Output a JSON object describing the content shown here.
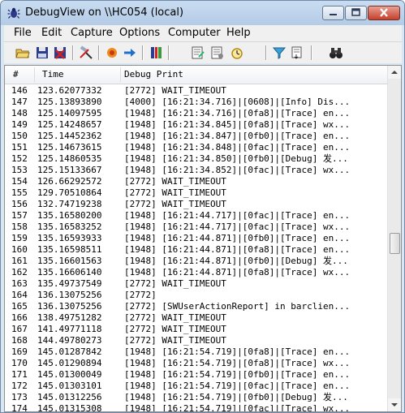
{
  "window": {
    "title": "DebugView on \\\\HC054 (local)"
  },
  "menu": [
    "File",
    "Edit",
    "Capture",
    "Options",
    "Computer",
    "Help"
  ],
  "toolbar": {
    "icons": [
      "open-icon",
      "save-icon",
      "clear-icon",
      "capture-icon",
      "autoscroll-icon",
      "find-icon",
      "filter-icon",
      "highlight-icon",
      "properties-icon",
      "timer-icon",
      "filter-funnel-icon",
      "history-icon",
      "binoculars-icon"
    ]
  },
  "columns": {
    "num": "#",
    "time": "Time",
    "print": "Debug Print"
  },
  "rows": [
    {
      "n": "146",
      "t": "123.62077332",
      "p": "[2772] WAIT_TIMEOUT"
    },
    {
      "n": "147",
      "t": "125.13893890",
      "p": "[4000] [16:21:34.716]|[0608]|[Info] Dis..."
    },
    {
      "n": "148",
      "t": "125.14097595",
      "p": "[1948] [16:21:34.716]|[0fa8]|[Trace] en..."
    },
    {
      "n": "149",
      "t": "125.14248657",
      "p": "[1948] [16:21:34.845]|[0fa8]|[Trace] wx..."
    },
    {
      "n": "150",
      "t": "125.14452362",
      "p": "[1948] [16:21:34.847]|[0fb0]|[Trace] en..."
    },
    {
      "n": "151",
      "t": "125.14673615",
      "p": "[1948] [16:21:34.848]|[0fac]|[Trace] en..."
    },
    {
      "n": "152",
      "p": "[1948] [16:21:34.850]|[0fb0]|[Debug] 发...",
      "t": "125.14860535"
    },
    {
      "n": "153",
      "t": "125.15133667",
      "p": "[1948] [16:21:34.852]|[0fac]|[Trace] wx..."
    },
    {
      "n": "154",
      "t": "126.66292572",
      "p": "[2772] WAIT_TIMEOUT"
    },
    {
      "n": "155",
      "t": "129.70510864",
      "p": "[2772] WAIT_TIMEOUT"
    },
    {
      "n": "156",
      "t": "132.74719238",
      "p": "[2772] WAIT_TIMEOUT"
    },
    {
      "n": "157",
      "t": "135.16580200",
      "p": "[1948] [16:21:44.717]|[0fac]|[Trace] en..."
    },
    {
      "n": "158",
      "t": "135.16583252",
      "p": "[1948] [16:21:44.717]|[0fac]|[Trace] wx..."
    },
    {
      "n": "159",
      "t": "135.16593933",
      "p": "[1948] [16:21:44.871]|[0fb0]|[Trace] en..."
    },
    {
      "n": "160",
      "t": "135.16598511",
      "p": "[1948] [16:21:44.871]|[0fa8]|[Trace] en..."
    },
    {
      "n": "161",
      "t": "135.16601563",
      "p": "[1948] [16:21:44.871]|[0fb0]|[Debug] 发..."
    },
    {
      "n": "162",
      "t": "135.16606140",
      "p": "[1948] [16:21:44.871]|[0fa8]|[Trace] wx..."
    },
    {
      "n": "163",
      "t": "135.49737549",
      "p": "[2772] WAIT_TIMEOUT"
    },
    {
      "n": "164",
      "t": "136.13075256",
      "p": "[2772]"
    },
    {
      "n": "165",
      "t": "136.13075256",
      "p": "[2772] [SWUserActionReport] in barclien..."
    },
    {
      "n": "166",
      "t": "138.49751282",
      "p": "[2772] WAIT_TIMEOUT"
    },
    {
      "n": "167",
      "t": "141.49771118",
      "p": "[2772] WAIT_TIMEOUT"
    },
    {
      "n": "168",
      "t": "144.49780273",
      "p": "[2772] WAIT_TIMEOUT"
    },
    {
      "n": "169",
      "t": "145.01287842",
      "p": "[1948] [16:21:54.719]|[0fa8]|[Trace] en..."
    },
    {
      "n": "170",
      "t": "145.01290894",
      "p": "[1948] [16:21:54.719]|[0fa8]|[Trace] wx..."
    },
    {
      "n": "171",
      "t": "145.01300049",
      "p": "[1948] [16:21:54.719]|[0fb0]|[Trace] en..."
    },
    {
      "n": "172",
      "t": "145.01303101",
      "p": "[1948] [16:21:54.719]|[0fac]|[Trace] en..."
    },
    {
      "n": "173",
      "t": "145.01312256",
      "p": "[1948] [16:21:54.719]|[0fb0]|[Debug] 发..."
    },
    {
      "n": "174",
      "t": "145.01315308",
      "p": "[1948] [16:21:54.719]|[0fac]|[Trace] wx..."
    }
  ]
}
